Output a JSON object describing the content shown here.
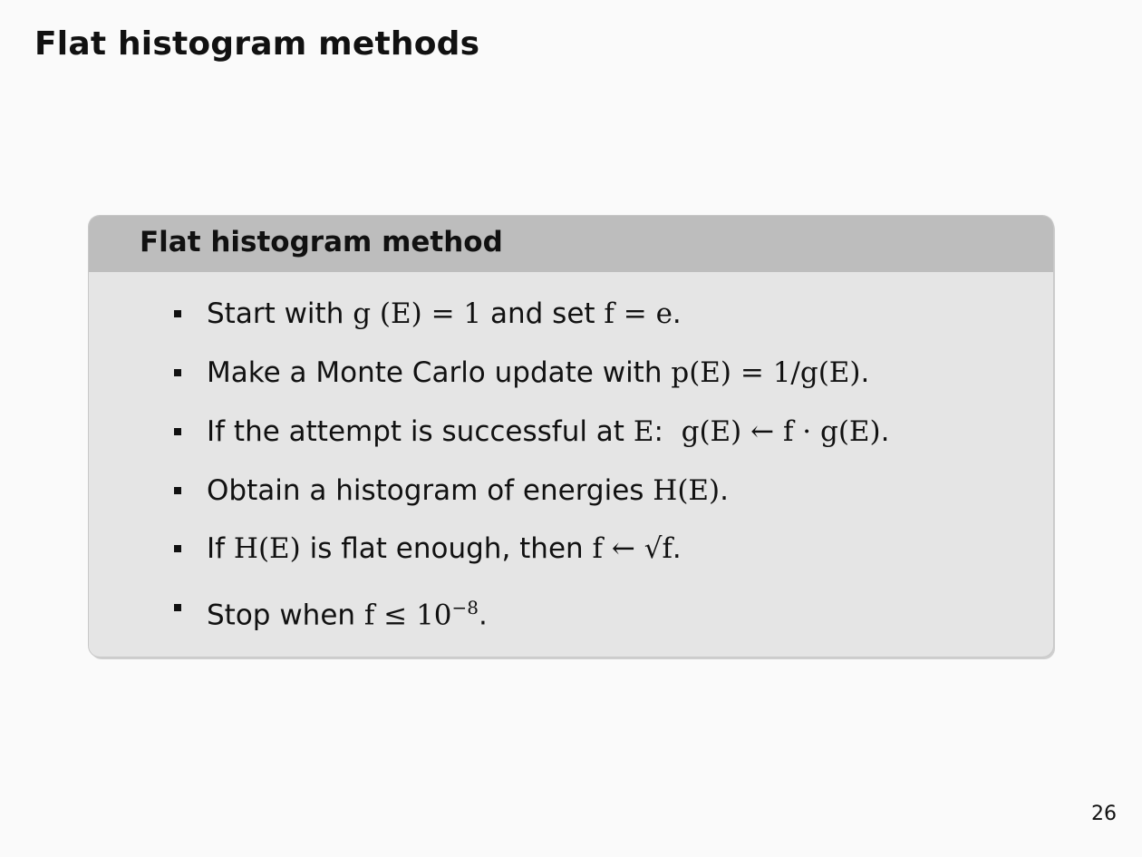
{
  "slide": {
    "title": "Flat histogram methods",
    "page_number": "26"
  },
  "block": {
    "title": "Flat histogram method",
    "items": [
      {
        "text": "Start with ",
        "math": "g (E) = 1",
        "text2": " and set ",
        "math2": "f = e",
        "tail": "."
      },
      {
        "text": "Make a Monte Carlo update with ",
        "math": "p(E) = 1/g(E)",
        "tail": "."
      },
      {
        "text": "If the attempt is successful at ",
        "math": "E",
        "text2": ":  ",
        "math2": "g(E) ← f · g(E)",
        "tail": "."
      },
      {
        "text": "Obtain a histogram of energies ",
        "math": "H(E)",
        "tail": "."
      },
      {
        "text": "If ",
        "math": "H(E)",
        "text2": " is flat enough, then ",
        "math2": "f ← √f",
        "tail": "."
      },
      {
        "text": "Stop when ",
        "math": "f ≤ 10",
        "sup": "−8",
        "tail": "."
      }
    ]
  }
}
